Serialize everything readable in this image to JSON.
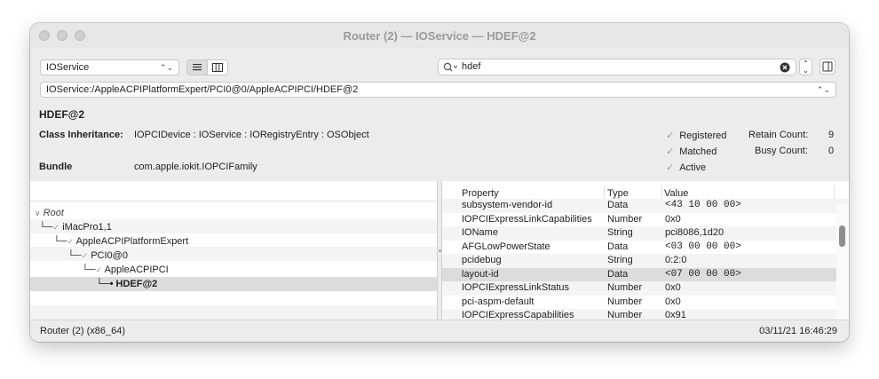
{
  "window": {
    "title": "Router (2) — IOService — HDEF@2"
  },
  "toolbar": {
    "plane_select": "IOService",
    "search_value": "hdef",
    "path": "IOService:/AppleACPIPlatformExpert/PCI0@0/AppleACPIPCI/HDEF@2"
  },
  "details": {
    "object_name": "HDEF@2",
    "class_inheritance_label": "Class Inheritance:",
    "class_inheritance_value": "IOPCIDevice : IOService : IORegistryEntry : OSObject",
    "bundle_label": "Bundle",
    "bundle_value": "com.apple.iokit.IOPCIFamily",
    "flags": {
      "registered": "Registered",
      "matched": "Matched",
      "active": "Active"
    },
    "retain_label": "Retain Count:",
    "retain_value": "9",
    "busy_label": "Busy Count:",
    "busy_value": "0"
  },
  "tree": [
    {
      "label": "Root"
    },
    {
      "label": "iMacPro1,1"
    },
    {
      "label": "AppleACPIPlatformExpert"
    },
    {
      "label": "PCI0@0"
    },
    {
      "label": "AppleACPIPCI"
    },
    {
      "label": "HDEF@2"
    }
  ],
  "table": {
    "headers": {
      "property": "Property",
      "type": "Type",
      "value": "Value"
    },
    "rows": [
      {
        "property": "subsystem-vendor-id",
        "type": "Data",
        "value": "<43 10 00 00>"
      },
      {
        "property": "IOPCIExpressLinkCapabilities",
        "type": "Number",
        "value": "0x0"
      },
      {
        "property": "IOName",
        "type": "String",
        "value": "pci8086,1d20"
      },
      {
        "property": "AFGLowPowerState",
        "type": "Data",
        "value": "<03 00 00 00>"
      },
      {
        "property": "pcidebug",
        "type": "String",
        "value": "0:2:0"
      },
      {
        "property": "layout-id",
        "type": "Data",
        "value": "<07 00 00 00>"
      },
      {
        "property": "IOPCIExpressLinkStatus",
        "type": "Number",
        "value": "0x0"
      },
      {
        "property": "pci-aspm-default",
        "type": "Number",
        "value": "0x0"
      },
      {
        "property": "IOPCIExpressCapabilities",
        "type": "Number",
        "value": "0x91"
      }
    ]
  },
  "status": {
    "left": "Router (2) (x86_64)",
    "right": "03/11/21 16:46:29"
  }
}
